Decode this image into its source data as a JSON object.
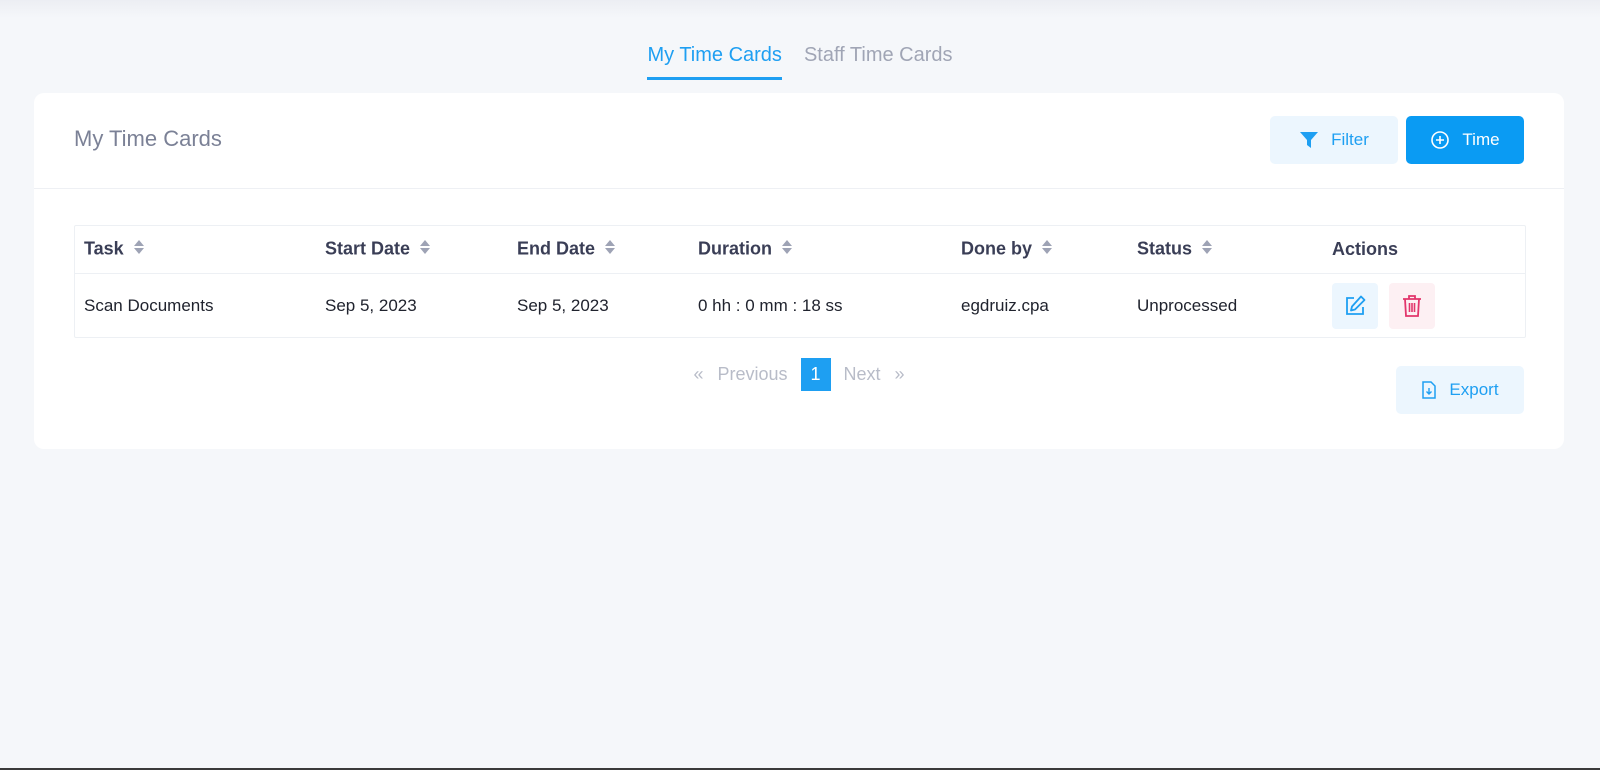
{
  "tabs": [
    {
      "label": "My Time Cards",
      "active": true
    },
    {
      "label": "Staff Time Cards",
      "active": false
    }
  ],
  "card": {
    "title": "My Time Cards",
    "filter_label": "Filter",
    "time_label": "Time",
    "export_label": "Export"
  },
  "table": {
    "headers": [
      "Task",
      "Start Date",
      "End Date",
      "Duration",
      "Done by",
      "Status",
      "Actions"
    ],
    "rows": [
      {
        "task": "Scan Documents",
        "start_date": "Sep 5, 2023",
        "end_date": "Sep 5, 2023",
        "duration": "0 hh : 0 mm : 18 ss",
        "done_by": "egdruiz.cpa",
        "status": "Unprocessed"
      }
    ]
  },
  "pagination": {
    "first": "«",
    "previous": "Previous",
    "current": "1",
    "next": "Next",
    "last": "»"
  },
  "icons": {
    "filter": "filter-icon",
    "time": "plus-circle-icon",
    "export": "file-export-icon",
    "edit": "edit-icon",
    "delete": "trash-icon",
    "sort": "sort-icon"
  },
  "colors": {
    "accent": "#1e9ff2",
    "primary_button": "#0a9bf3",
    "danger": "#e2366c",
    "background": "#f5f7fa"
  }
}
